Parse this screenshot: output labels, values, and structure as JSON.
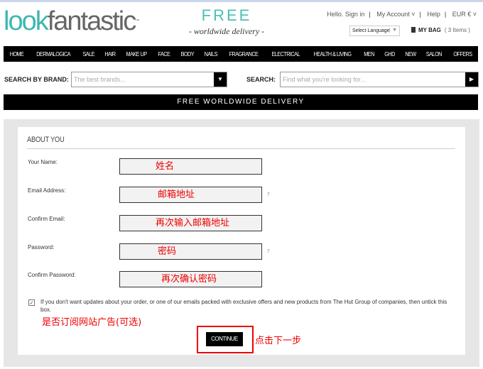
{
  "header": {
    "logo_a": "look",
    "logo_b": "fantastic",
    "logo_tm": "™",
    "free": "FREE",
    "free_sub": "- worldwide delivery -",
    "links": [
      "Hello. Sign in",
      "My Account ˅",
      "Help",
      "EUR € ˅"
    ],
    "language": "Select Language",
    "language_arrow": "▼",
    "bag_label": "MY BAG",
    "bag_count": "( 3 Items )"
  },
  "nav": [
    "HOME",
    "DERMALOGICA",
    "SALE",
    "HAIR",
    "MAKE UP",
    "FACE",
    "BODY",
    "NAILS",
    "FRAGRANCE",
    "ELECTRICAL",
    "HEALTH & LIVING",
    "MEN",
    "GHD",
    "NEW",
    "SALON",
    "OFFERS"
  ],
  "search": {
    "brand_label": "SEARCH BY BRAND:",
    "brand_placeholder": "The best brands...",
    "brand_arrow": "▼",
    "label": "SEARCH:",
    "placeholder": "Find what you're looking for...",
    "go": "▶"
  },
  "banner": "FREE WORLDWIDE DELIVERY",
  "form": {
    "heading": "ABOUT YOU",
    "fields": [
      {
        "label": "Your Name:",
        "value": "姓名"
      },
      {
        "label": "Email Address:",
        "value": "邮箱地址",
        "help": "?"
      },
      {
        "label": "Confirm Email:",
        "value": "再次输入邮箱地址"
      },
      {
        "label": "Password:",
        "value": "密码",
        "help": "?"
      },
      {
        "label": "Confirm Password:",
        "value": "再次确认密码"
      }
    ],
    "checkbox_checked": true,
    "checkbox_mark": "✓",
    "note": "If you don't want updates about your order, or one of our emails packed with exclusive offers and new products from The Hut Group of companies, then untick this box.",
    "annotation_subscribe": "是否订阅网站广告(可选)",
    "continue": "CONTINUE",
    "annotation_continue": "点击下一步"
  },
  "colors": {
    "brand_teal": "#3cb8b0",
    "annotation_red": "#e00000"
  }
}
